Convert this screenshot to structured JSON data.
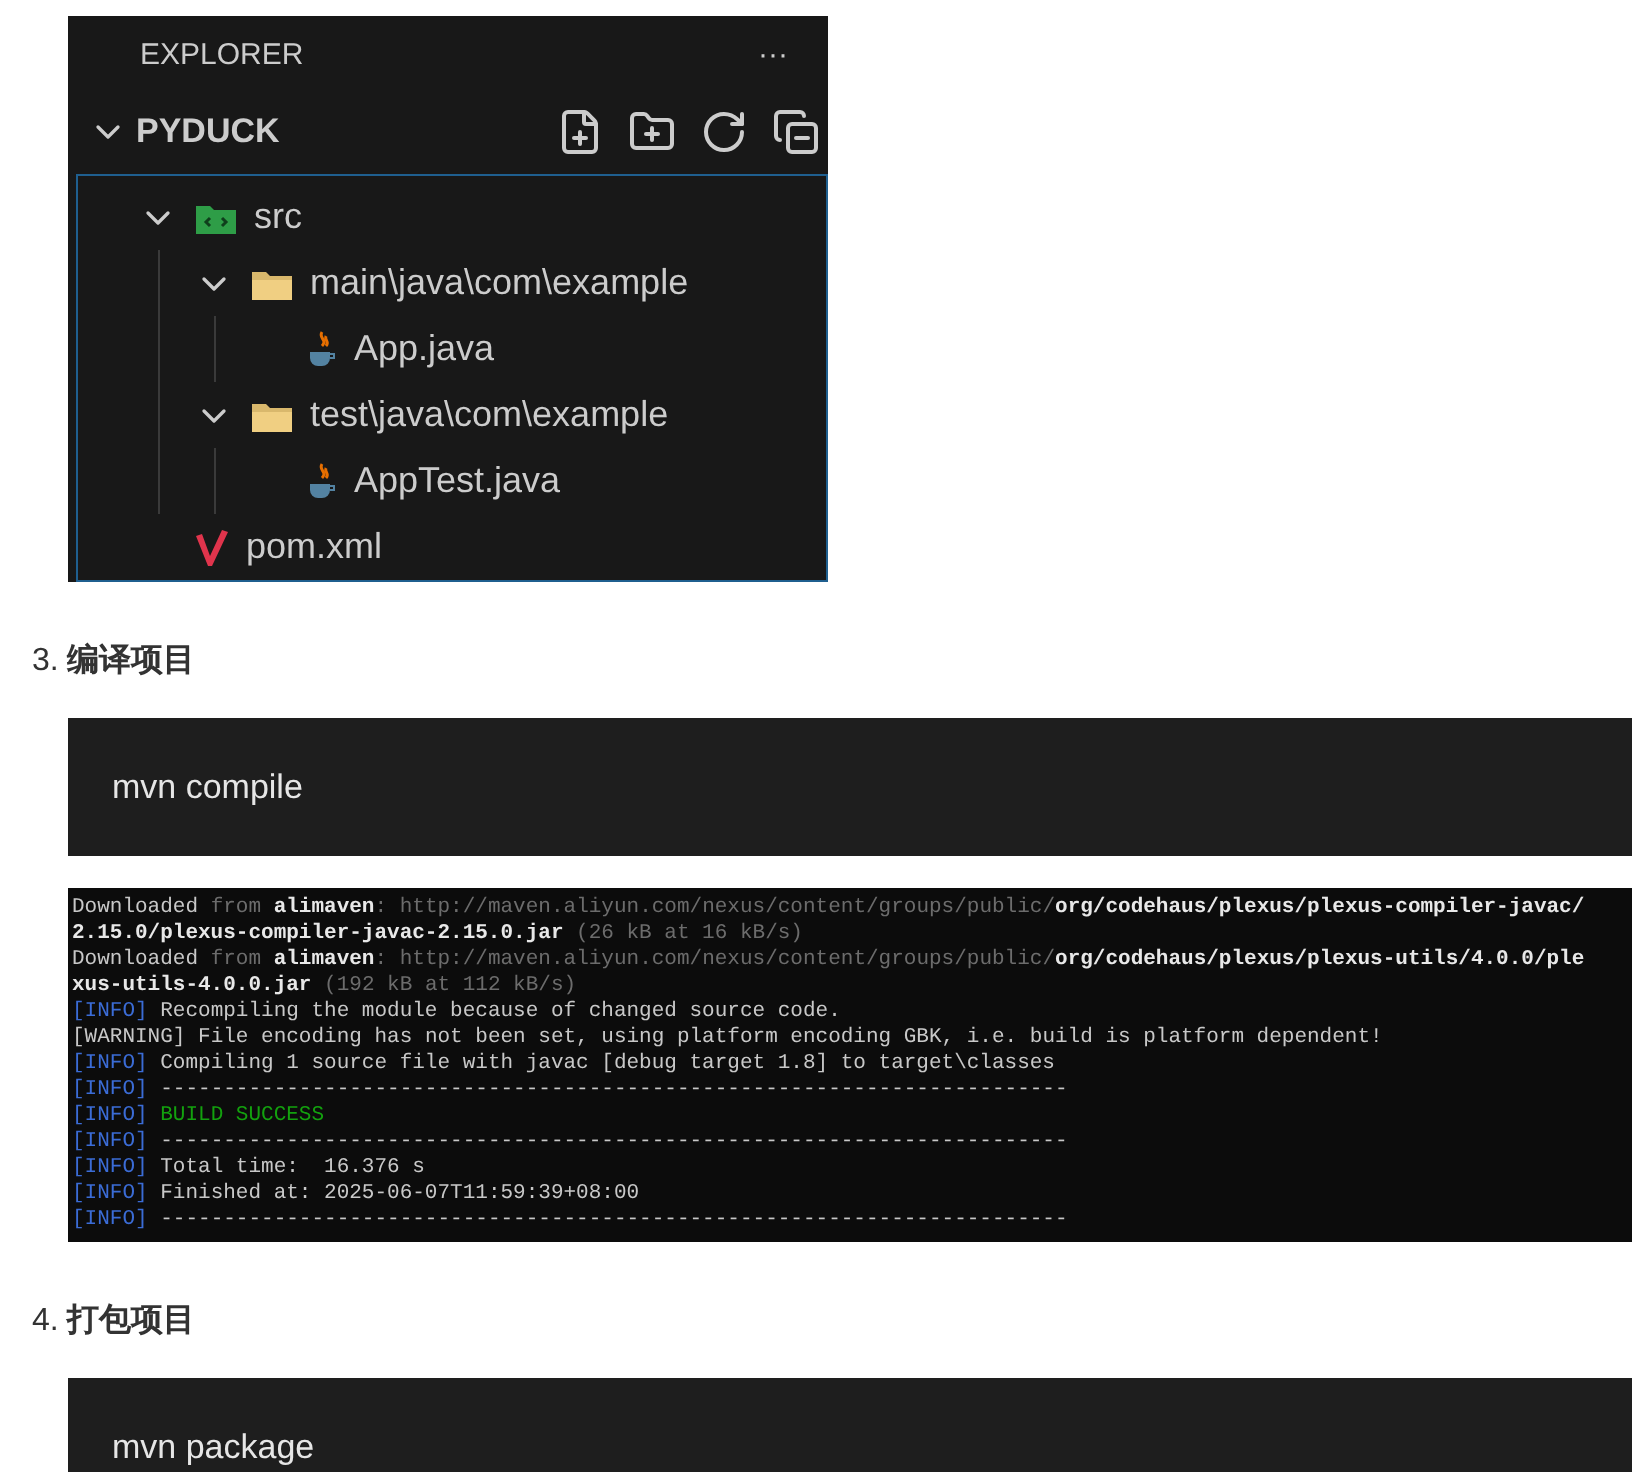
{
  "explorer": {
    "title": "EXPLORER",
    "more": "···",
    "project": {
      "name": "PYDUCK",
      "expanded": true
    },
    "tree": [
      {
        "name": "src",
        "kind": "src-folder",
        "expanded": true,
        "children": [
          {
            "name": "main\\java\\com\\example",
            "kind": "folder",
            "expanded": true,
            "children": [
              {
                "name": "App.java",
                "kind": "java"
              }
            ]
          },
          {
            "name": "test\\java\\com\\example",
            "kind": "folder",
            "expanded": true,
            "children": [
              {
                "name": "AppTest.java",
                "kind": "java"
              }
            ]
          }
        ]
      },
      {
        "name": "pom.xml",
        "kind": "maven"
      }
    ]
  },
  "steps": [
    {
      "number": "3.",
      "title": "编译项目",
      "command": "mvn compile",
      "terminal": [
        [
          {
            "kind": "normal",
            "text": "Downloaded"
          },
          {
            "kind": "dim",
            "text": " from "
          },
          {
            "kind": "bright",
            "text": "alimaven"
          },
          {
            "kind": "dim",
            "text": ": http://maven.aliyun.com/nexus/content/groups/public/"
          },
          {
            "kind": "bright",
            "text": "org/codehaus/plexus/plexus-compiler-javac/"
          }
        ],
        [
          {
            "kind": "bright",
            "text": "2.15.0/plexus-compiler-javac-2.15.0.jar"
          },
          {
            "kind": "dim",
            "text": " (26 kB at 16 kB/s)"
          }
        ],
        [
          {
            "kind": "normal",
            "text": "Downloaded"
          },
          {
            "kind": "dim",
            "text": " from "
          },
          {
            "kind": "bright",
            "text": "alimaven"
          },
          {
            "kind": "dim",
            "text": ": http://maven.aliyun.com/nexus/content/groups/public/"
          },
          {
            "kind": "bright",
            "text": "org/codehaus/plexus/plexus-utils/4.0.0/ple"
          }
        ],
        [
          {
            "kind": "bright",
            "text": "xus-utils-4.0.0.jar"
          },
          {
            "kind": "dim",
            "text": " (192 kB at 112 kB/s)"
          }
        ],
        [
          {
            "kind": "info",
            "text": "[INFO]"
          },
          {
            "kind": "normal",
            "text": " Recompiling the module because of changed source code."
          }
        ],
        [
          {
            "kind": "warn",
            "text": "[WARNING]"
          },
          {
            "kind": "normal",
            "text": " File encoding has not been set, using platform encoding GBK, i.e. build is platform dependent!"
          }
        ],
        [
          {
            "kind": "info",
            "text": "[INFO]"
          },
          {
            "kind": "normal",
            "text": " Compiling 1 source file with javac [debug target 1.8] to target\\classes"
          }
        ],
        [
          {
            "kind": "info",
            "text": "[INFO]"
          },
          {
            "kind": "normal",
            "text": " ------------------------------------------------------------------------"
          }
        ],
        [
          {
            "kind": "info",
            "text": "[INFO]"
          },
          {
            "kind": "success",
            "text": " BUILD SUCCESS"
          }
        ],
        [
          {
            "kind": "info",
            "text": "[INFO]"
          },
          {
            "kind": "normal",
            "text": " ------------------------------------------------------------------------"
          }
        ],
        [
          {
            "kind": "info",
            "text": "[INFO]"
          },
          {
            "kind": "normal",
            "text": " Total time:  16.376 s"
          }
        ],
        [
          {
            "kind": "info",
            "text": "[INFO]"
          },
          {
            "kind": "normal",
            "text": " Finished at: 2025-06-07T11:59:39+08:00"
          }
        ],
        [
          {
            "kind": "info",
            "text": "[INFO]"
          },
          {
            "kind": "normal",
            "text": " ------------------------------------------------------------------------"
          }
        ]
      ]
    },
    {
      "number": "4.",
      "title": "打包项目",
      "command": "mvn package"
    }
  ]
}
